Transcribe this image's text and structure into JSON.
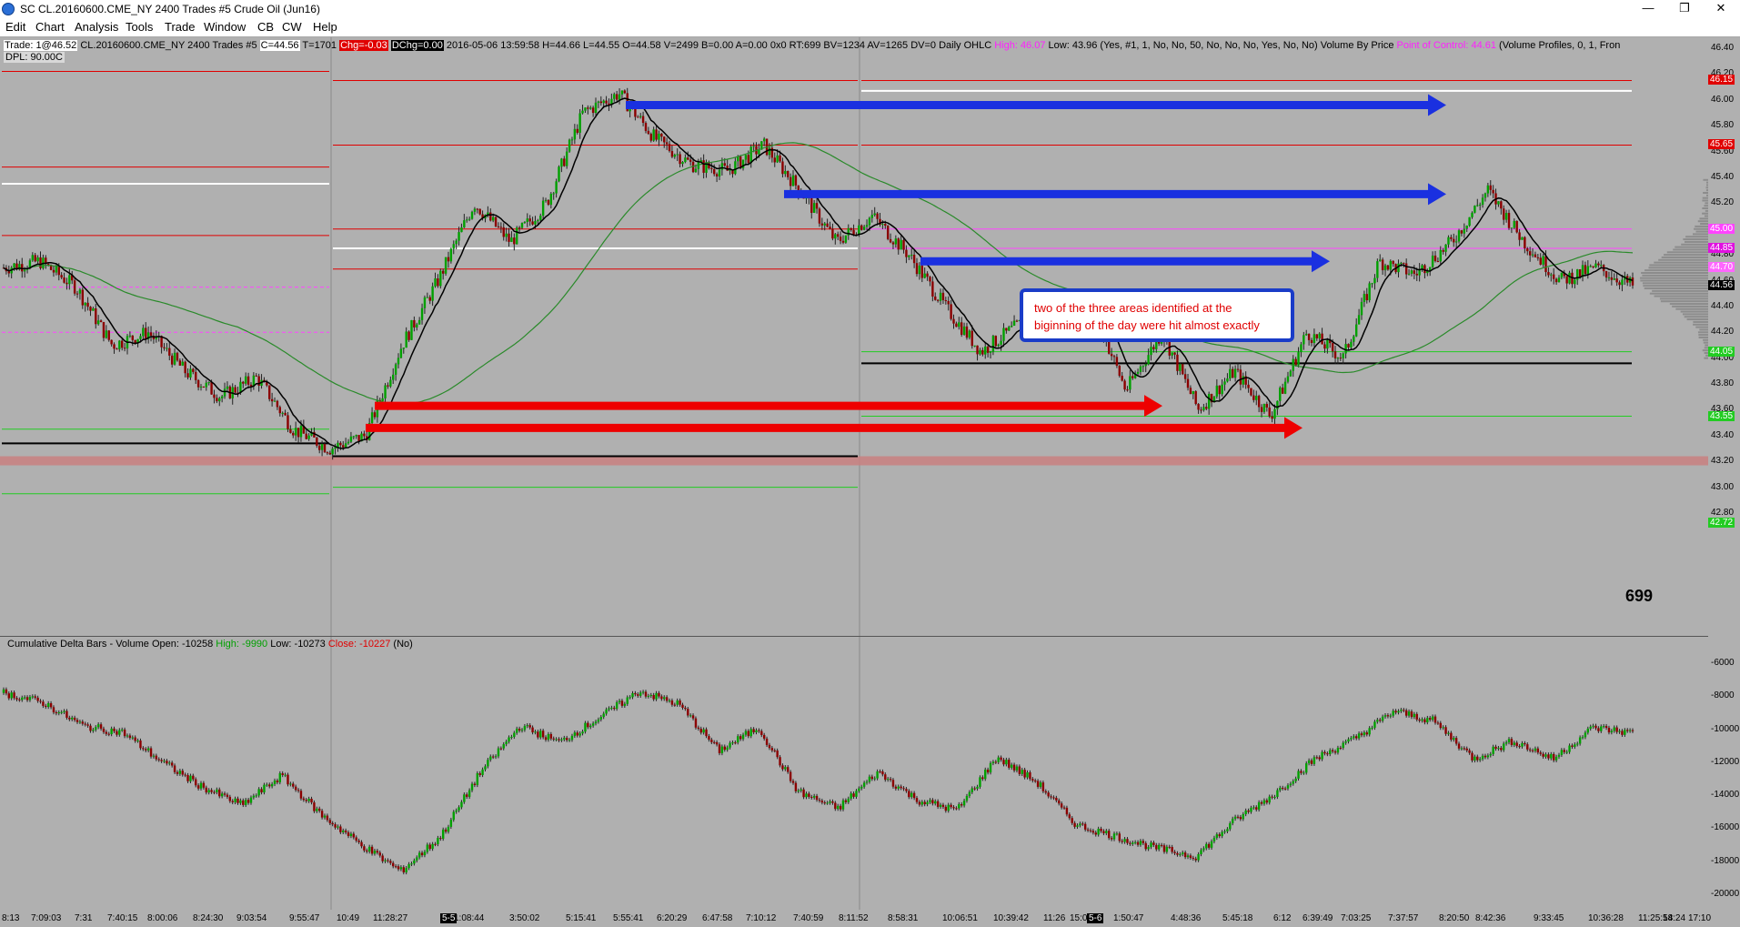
{
  "window": {
    "title": "SC CL.20160600.CME_NY  2400 Trades  #5  Crude Oil (Jun16)",
    "buttons": [
      "—",
      "❐",
      "✕"
    ]
  },
  "menu": [
    "Edit",
    "Chart",
    "Analysis",
    "Tools",
    "Trade",
    "Window",
    "CB",
    "CW",
    "Help"
  ],
  "info_bar": {
    "trade": "Trade: 1@46.52",
    "symbol": "CL.20160600.CME_NY  2400 Trades  #5",
    "close": "C=44.56",
    "trades": "T=1701",
    "chg": "Chg=-0.03",
    "dchg": "DChg=0.00",
    "bar_info": "2016-05-06  13:59:58  H=44.66  L=44.55  O=44.58  V=2499  B=0.00  A=0.00  0x0  RT:699  BV=1234  AV=1265  DV=0  Daily OHLC",
    "high": "High: 46.07",
    "low": "Low: 43.96",
    "study_params": "(Yes, #1, 1, No, No, 50, No, No, No, Yes, No, No)  Volume By Price",
    "poc": "Point of Control: 44.61",
    "vp": "(Volume Profiles, 0, 1, Fron",
    "dpl": "DPL: 90.00C"
  },
  "annotation": "two of the three areas identified at the biginning of the day were hit almost exactly",
  "bar_count": "699",
  "price_axis": {
    "ticks": [
      "46.40",
      "46.20",
      "46.00",
      "45.80",
      "45.60",
      "45.40",
      "45.20",
      "45.00",
      "44.80",
      "44.60",
      "44.40",
      "44.20",
      "44.00",
      "43.80",
      "43.60",
      "43.40",
      "43.20",
      "43.00",
      "42.80"
    ],
    "tags": [
      {
        "label": "46.15",
        "value": 46.15,
        "bg": "#e00000",
        "fg": "#ffffff"
      },
      {
        "label": "45.65",
        "value": 45.65,
        "bg": "#e00000",
        "fg": "#ffffff"
      },
      {
        "label": "45.00",
        "value": 45.0,
        "bg": "#ff44ff",
        "fg": "#ffffff"
      },
      {
        "label": "44.85",
        "value": 44.85,
        "bg": "#e010e0",
        "fg": "#ffffff"
      },
      {
        "label": "44.70",
        "value": 44.7,
        "bg": "#ff66ff",
        "fg": "#ffffff"
      },
      {
        "label": "44.56",
        "value": 44.56,
        "bg": "#000000",
        "fg": "#ffffff"
      },
      {
        "label": "44.05",
        "value": 44.05,
        "bg": "#22cc22",
        "fg": "#ffffff"
      },
      {
        "label": "43.55",
        "value": 43.55,
        "bg": "#22cc22",
        "fg": "#ffffff"
      },
      {
        "label": "42.72",
        "value": 42.72,
        "bg": "#22cc22",
        "fg": "#ffffff"
      }
    ]
  },
  "delta_panel": {
    "header": "Cumulative Delta Bars - Volume  Open: -10258",
    "high": "High: -9990",
    "low": "Low: -10273",
    "close": "Close: -10227",
    "tail": "(No)",
    "ticks": [
      "-6000",
      "-8000",
      "-10000",
      "-12000",
      "-14000",
      "-16000",
      "-18000",
      "-20000"
    ]
  },
  "time_axis": {
    "labels": [
      "8:13",
      "7:09:03",
      "7:31",
      "7:40:15",
      "8:00:06",
      "8:24:30",
      "9:03:54",
      "9:55:47",
      "10:49",
      "11:28:27",
      "1:08:44",
      "3:50:02",
      "5:15:41",
      "5:55:41",
      "6:20:29",
      "6:47:58",
      "7:10:12",
      "7:40:59",
      "8:11:52",
      "8:58:31",
      "10:06:51",
      "10:39:42",
      "11:26",
      "15:00",
      "1:50:47",
      "4:48:36",
      "5:45:18",
      "6:12",
      "6:39:49",
      "7:03:25",
      "7:37:57",
      "8:20:50",
      "8:42:36",
      "9:33:45",
      "10:36:28",
      "11:25:58",
      "14:24",
      "17:10"
    ],
    "session_markers": [
      "5-5",
      "5-6"
    ]
  },
  "colors": {
    "background": "#b0b0b0",
    "resistance_line": "#e00000",
    "support_line": "#22cc22",
    "arrow_blue": "#1a30e0",
    "arrow_red": "#ee0000",
    "up_bar": "#00a000",
    "down_bar": "#8b0000",
    "moving_avg_fast": "#000000",
    "moving_avg_slow": "#2a8a2a"
  },
  "chart_data": {
    "type": "candlestick",
    "instrument": "CL.20160600.CME_NY",
    "ylim": [
      42.72,
      46.5
    ],
    "levels": {
      "red": [
        46.22,
        45.48,
        44.95,
        45.65,
        45.0,
        44.69,
        46.15,
        45.65
      ],
      "white": [
        45.35,
        44.85,
        46.07
      ],
      "black": [
        43.34,
        43.24,
        43.96
      ],
      "green": [
        43.45,
        42.95,
        43.0,
        44.05,
        43.55
      ],
      "magenta": [
        44.55,
        44.2,
        44.85,
        45.0
      ]
    },
    "price_path": [
      44.7,
      44.75,
      44.55,
      44.1,
      44.2,
      43.9,
      43.7,
      43.85,
      43.45,
      43.3,
      43.4,
      44.1,
      44.6,
      45.2,
      44.9,
      45.2,
      45.9,
      46.05,
      45.7,
      45.5,
      45.45,
      45.65,
      45.3,
      44.9,
      45.1,
      44.8,
      44.4,
      44.05,
      44.25,
      44.4,
      44.45,
      43.75,
      44.2,
      43.6,
      43.9,
      43.55,
      44.2,
      44.0,
      44.75,
      44.65,
      44.9,
      45.3,
      44.9,
      44.6,
      44.7,
      44.56
    ],
    "delta_path": [
      -7800,
      -8400,
      -9800,
      -10200,
      -12000,
      -13500,
      -14600,
      -12800,
      -15200,
      -17000,
      -18600,
      -16500,
      -12600,
      -9800,
      -10800,
      -9300,
      -7700,
      -8500,
      -11300,
      -9900,
      -13800,
      -14800,
      -12600,
      -14300,
      -14900,
      -11700,
      -13200,
      -15800,
      -16500,
      -17200,
      -17700,
      -15500,
      -13900,
      -11800,
      -10600,
      -8900,
      -9500,
      -11800,
      -10700,
      -11800,
      -9900,
      -10227
    ]
  }
}
